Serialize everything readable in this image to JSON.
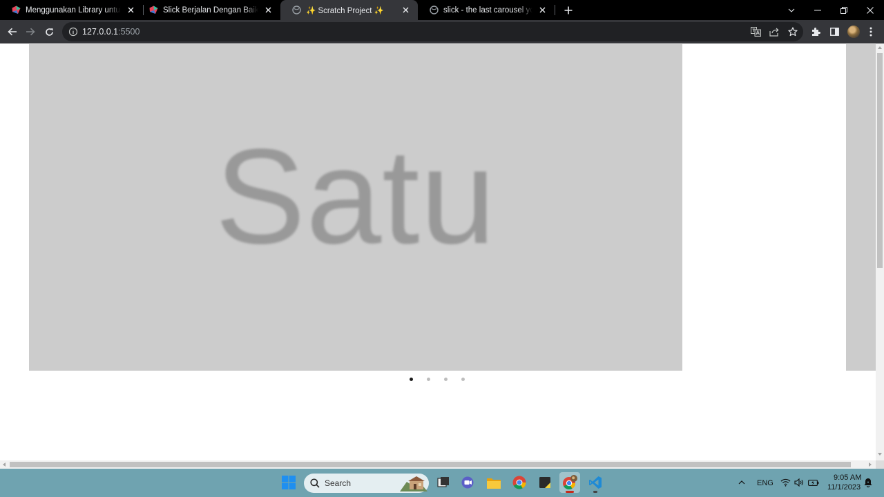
{
  "browser": {
    "tabs": [
      {
        "title": "Menggunakan Library untuk JQuery",
        "favicon": "slick-logo-icon",
        "active": false
      },
      {
        "title": "Slick Berjalan Dengan Baik Tetapi",
        "favicon": "slick-logo-icon",
        "active": false
      },
      {
        "title": "✨ Scratch Project ✨",
        "favicon": "globe-icon",
        "active": true
      },
      {
        "title": "slick - the last carousel you'll ever need",
        "favicon": "globe-icon",
        "active": false
      }
    ],
    "url_host": "127.0.0.1",
    "url_port": ":5500"
  },
  "page": {
    "slide_text": "Satu",
    "dots_count": 4,
    "active_dot": 0,
    "colors": {
      "slide_bg": "#cccccc",
      "slide_text": "#999999",
      "dot_active": "#1a1a1a",
      "dot_inactive": "#bdbdbd"
    }
  },
  "taskbar": {
    "search_label": "Search",
    "language": "ENG",
    "time": "9:05 AM",
    "date": "11/1/2023",
    "apps": [
      "start-icon",
      "task-view-icon",
      "teams-meet-icon",
      "file-explorer-icon",
      "chrome-icon",
      "sticky-notes-icon",
      "chrome-profile-icon",
      "vscode-icon"
    ]
  }
}
